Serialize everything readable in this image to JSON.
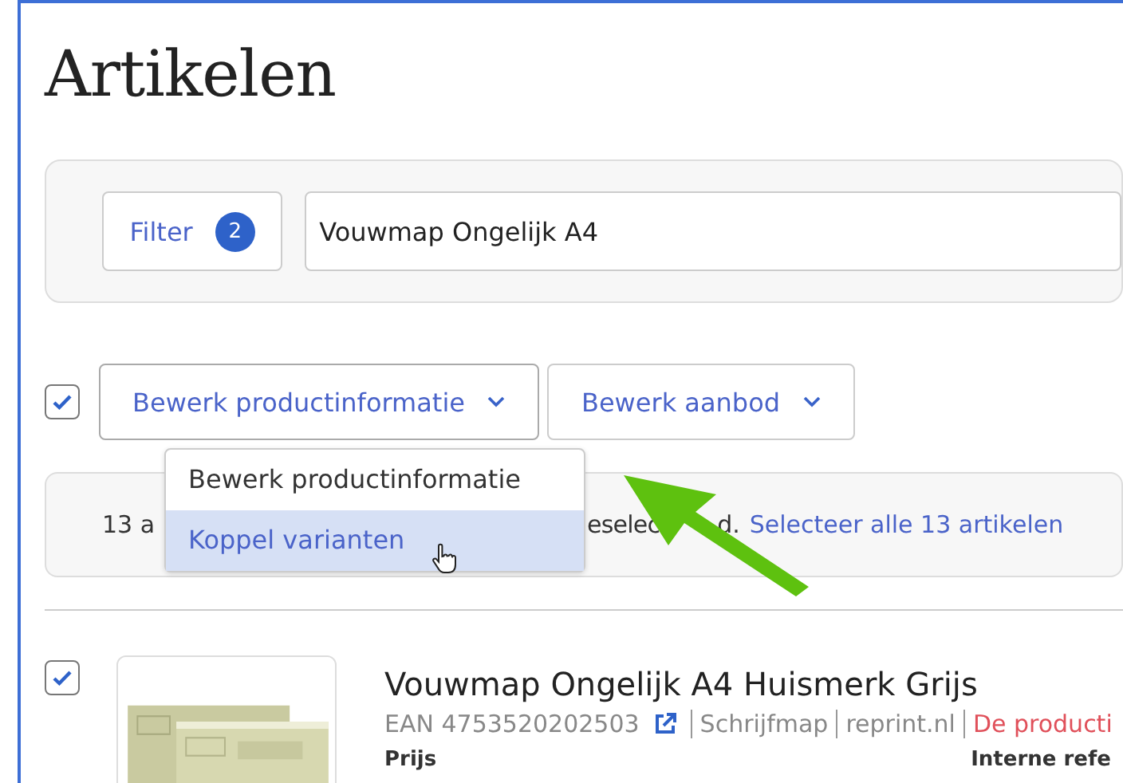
{
  "title": "Artikelen",
  "filter": {
    "label": "Filter",
    "count": "2"
  },
  "search": {
    "value": "Vouwmap Ongelijk A4"
  },
  "toolbar": {
    "select_all_checked": true,
    "buttons": [
      {
        "label": "Bewerk productinformatie",
        "expanded": true
      },
      {
        "label": "Bewerk aanbod",
        "expanded": false
      }
    ]
  },
  "dropdown": {
    "items": [
      {
        "label": "Bewerk productinformatie",
        "selected": false
      },
      {
        "label": "Koppel varianten",
        "selected": true
      }
    ]
  },
  "selection_banner": {
    "text_start": "13 a",
    "text_mid": "eselec",
    "text_end": "d.",
    "link": "Selecteer alle 13 artikelen"
  },
  "products": [
    {
      "checked": true,
      "name": "Vouwmap Ongelijk A4 Huismerk Grijs",
      "ean": "EAN 4753520202503",
      "category": "Schrijfmap",
      "supplier": "reprint.nl",
      "warning": "De producti",
      "label_1": "Prijs",
      "label_2": "Interne refe"
    }
  ]
}
